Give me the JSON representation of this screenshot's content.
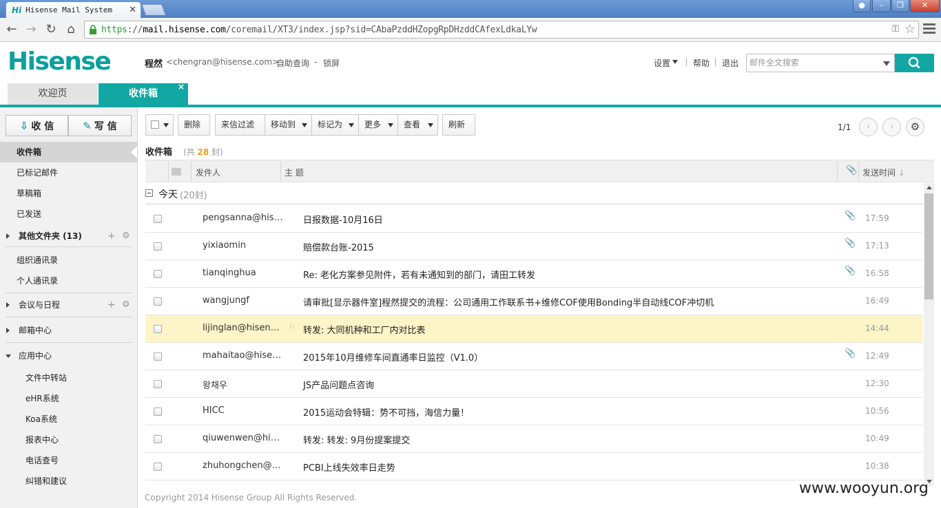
{
  "browser": {
    "tab_title": "Hisense Mail System",
    "tab_favicon": "Hi",
    "url_scheme": "https",
    "url_sep": "://",
    "url_host": "mail.hisense.com",
    "url_path": "/coremail/XT3/index.jsp?sid=CAbaPzddHZopgRpDHzddCAfexLdkaLYw"
  },
  "header": {
    "logo": "Hisense",
    "user_name": "程然",
    "user_email": "<chengran@hisense.com>",
    "self_service": "自助查询",
    "separator": "-",
    "lock_screen": "锁屏",
    "settings": "设置",
    "help": "帮助",
    "logout": "退出",
    "search_placeholder": "邮件全文搜索"
  },
  "tabs": {
    "welcome": "欢迎页",
    "inbox": "收件箱",
    "close": "×"
  },
  "sidebar": {
    "receive": "收 信",
    "compose": "写 信",
    "items": [
      "收件箱",
      "已标记邮件",
      "草稿箱",
      "已发送"
    ],
    "other_folders": "其他文件夹 (13)",
    "org_contacts": "组织通讯录",
    "personal_contacts": "个人通讯录",
    "meetings": "会议与日程",
    "mailbox_center": "邮箱中心",
    "app_center": "应用中心",
    "apps": [
      "文件中转站",
      "eHR系统",
      "Koa系统",
      "报表中心",
      "电话查号",
      "纠错和建议"
    ]
  },
  "toolbar": {
    "delete": "删除",
    "filter": "来信过滤",
    "move": "移动到",
    "mark": "标记为",
    "more": "更多",
    "view": "查看",
    "refresh": "刷新",
    "page": "1/1"
  },
  "folder": {
    "title": "收件箱",
    "count_prefix": "(共",
    "count": "28",
    "count_suffix": "封)"
  },
  "list_header": {
    "sender": "发件人",
    "subject": "主  题",
    "time": "发送时间"
  },
  "group": {
    "label": "今天",
    "count": "(20封)"
  },
  "emails": [
    {
      "sender": "pengsanna@hisense.com",
      "subject": "日报数据-10月16日",
      "time": "17:59",
      "attach": true
    },
    {
      "sender": "yixiaomin",
      "subject": "赔偿款台账-2015",
      "time": "17:13",
      "attach": true
    },
    {
      "sender": "tianqinghua",
      "subject": "Re: 老化方案参见附件，若有未通知到的部门，请田工转发",
      "time": "16:58",
      "attach": true
    },
    {
      "sender": "wangjungf",
      "subject": "请审批[显示器件室]程然提交的流程：公司通用工作联系书+维修COF使用Bonding半自动线COF冲切机",
      "time": "16:49",
      "attach": false
    },
    {
      "sender": "lijinglan@hisense.com",
      "subject": "转发: 大同机种和工厂内对比表",
      "time": "14:44",
      "attach": false,
      "highlight": true
    },
    {
      "sender": "mahaitao@hisense.com",
      "subject": "2015年10月维修车间直通率日监控（V1.0）",
      "time": "12:49",
      "attach": true
    },
    {
      "sender": "왕채우",
      "subject": "JS产品问题点咨询",
      "time": "12:30",
      "attach": false
    },
    {
      "sender": "HICC",
      "subject": "2015运动会特辑：势不可挡，海信力量！",
      "time": "10:56",
      "attach": false
    },
    {
      "sender": "qiuwenwen@hisense.com",
      "subject": "转发: 转发: 9月份提案提交",
      "time": "10:49",
      "attach": false
    },
    {
      "sender": "zhuhongchen@hisense.com",
      "subject": "PCBI上线失效率日走势",
      "time": "10:38",
      "attach": false
    }
  ],
  "footer": {
    "copyright": "Copyright 2014 Hisense Group All Rights Reserved.",
    "watermark": "www.wooyun.org"
  },
  "icons": {
    "attach": "📎",
    "flag": "⚐",
    "plus": "+",
    "gear": "⚙",
    "prev": "‹",
    "next": "›"
  },
  "colors": {
    "brand": "#13a7a4",
    "highlight_row": "#fdf4c7",
    "count_accent": "#f39a1e"
  }
}
